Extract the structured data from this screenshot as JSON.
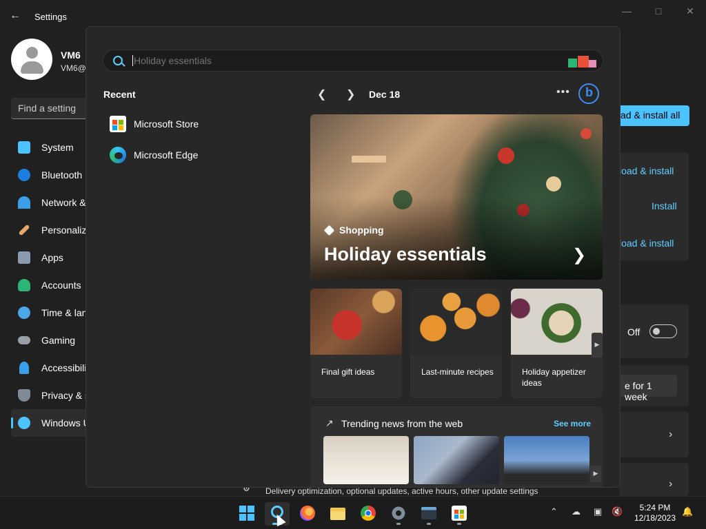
{
  "settings": {
    "title": "Settings",
    "profile": {
      "name": "VM6",
      "email": "VM6@"
    },
    "find_placeholder": "Find a setting",
    "nav": [
      {
        "label": "System",
        "color": "#4cc2ff"
      },
      {
        "label": "Bluetooth",
        "color": "#1e7de0"
      },
      {
        "label": "Network &",
        "color": "#3b9ee8"
      },
      {
        "label": "Personaliz",
        "color": "#e8a86b"
      },
      {
        "label": "Apps",
        "color": "#8a9bb0"
      },
      {
        "label": "Accounts",
        "color": "#2bb673"
      },
      {
        "label": "Time & lan",
        "color": "#4aa8e8"
      },
      {
        "label": "Gaming",
        "color": "#9aa0a6"
      },
      {
        "label": "Accessibili",
        "color": "#3b9ee8"
      },
      {
        "label": "Privacy & s",
        "color": "#7f8a96"
      },
      {
        "label": "Windows U",
        "color": "#4cc2ff"
      }
    ],
    "right": {
      "download_all": "ad & install all",
      "download_install_1": "load & install",
      "install": "Install",
      "download_install_2": "load & install",
      "off": "Off",
      "pause": "e for 1 week"
    },
    "delivery": "Delivery optimization, optional updates, active hours, other update settings"
  },
  "search": {
    "placeholder": "Holiday essentials",
    "recent_title": "Recent",
    "recent": [
      {
        "label": "Microsoft Store",
        "icon": "store-icon"
      },
      {
        "label": "Microsoft Edge",
        "icon": "edge-icon"
      }
    ],
    "date": "Dec 18",
    "hero": {
      "category": "Shopping",
      "title": "Holiday essentials"
    },
    "tiles": [
      {
        "label": "Final gift ideas"
      },
      {
        "label": "Last-minute recipes"
      },
      {
        "label": "Holiday appetizer ideas"
      }
    ],
    "trending": {
      "title": "Trending news from the web",
      "see_more": "See more"
    }
  },
  "taskbar": {
    "clock_time": "5:24 PM",
    "clock_date": "12/18/2023"
  }
}
